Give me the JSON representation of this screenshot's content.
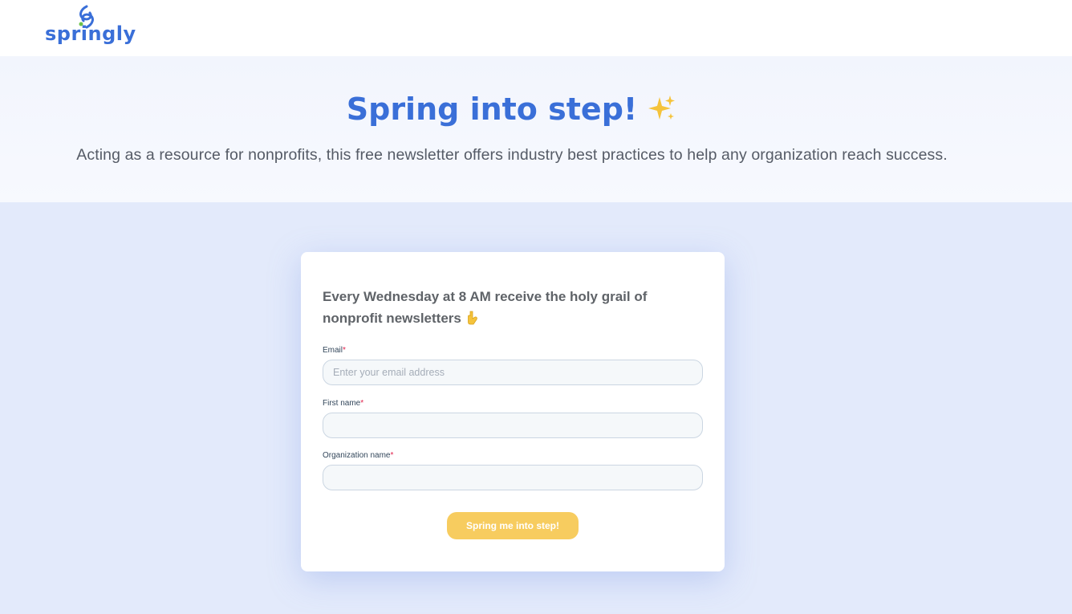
{
  "brand": {
    "logo_text": "springly",
    "logo_icon": "springly-logo-icon",
    "color": "#3a6fd8"
  },
  "hero": {
    "title": "Spring into step!",
    "title_icon": "sparkles-icon",
    "subtitle": "Acting as a resource for nonprofits, this free newsletter offers industry best practices to help any organization reach success."
  },
  "form": {
    "heading": "Every Wednesday at 8 AM receive the holy grail of nonprofit newsletters",
    "heading_icon": "pointing-down-icon",
    "required_mark": "*",
    "fields": [
      {
        "label": "Email",
        "placeholder": "Enter your email address",
        "value": ""
      },
      {
        "label": "First name",
        "placeholder": "",
        "value": ""
      },
      {
        "label": "Organization name",
        "placeholder": "",
        "value": ""
      }
    ],
    "submit_label": "Spring me into step!",
    "submit_color": "#f7cc5f"
  },
  "colors": {
    "hero_background": "#f2f5fd",
    "main_background": "#e3eafb",
    "required": "#e0204a"
  }
}
